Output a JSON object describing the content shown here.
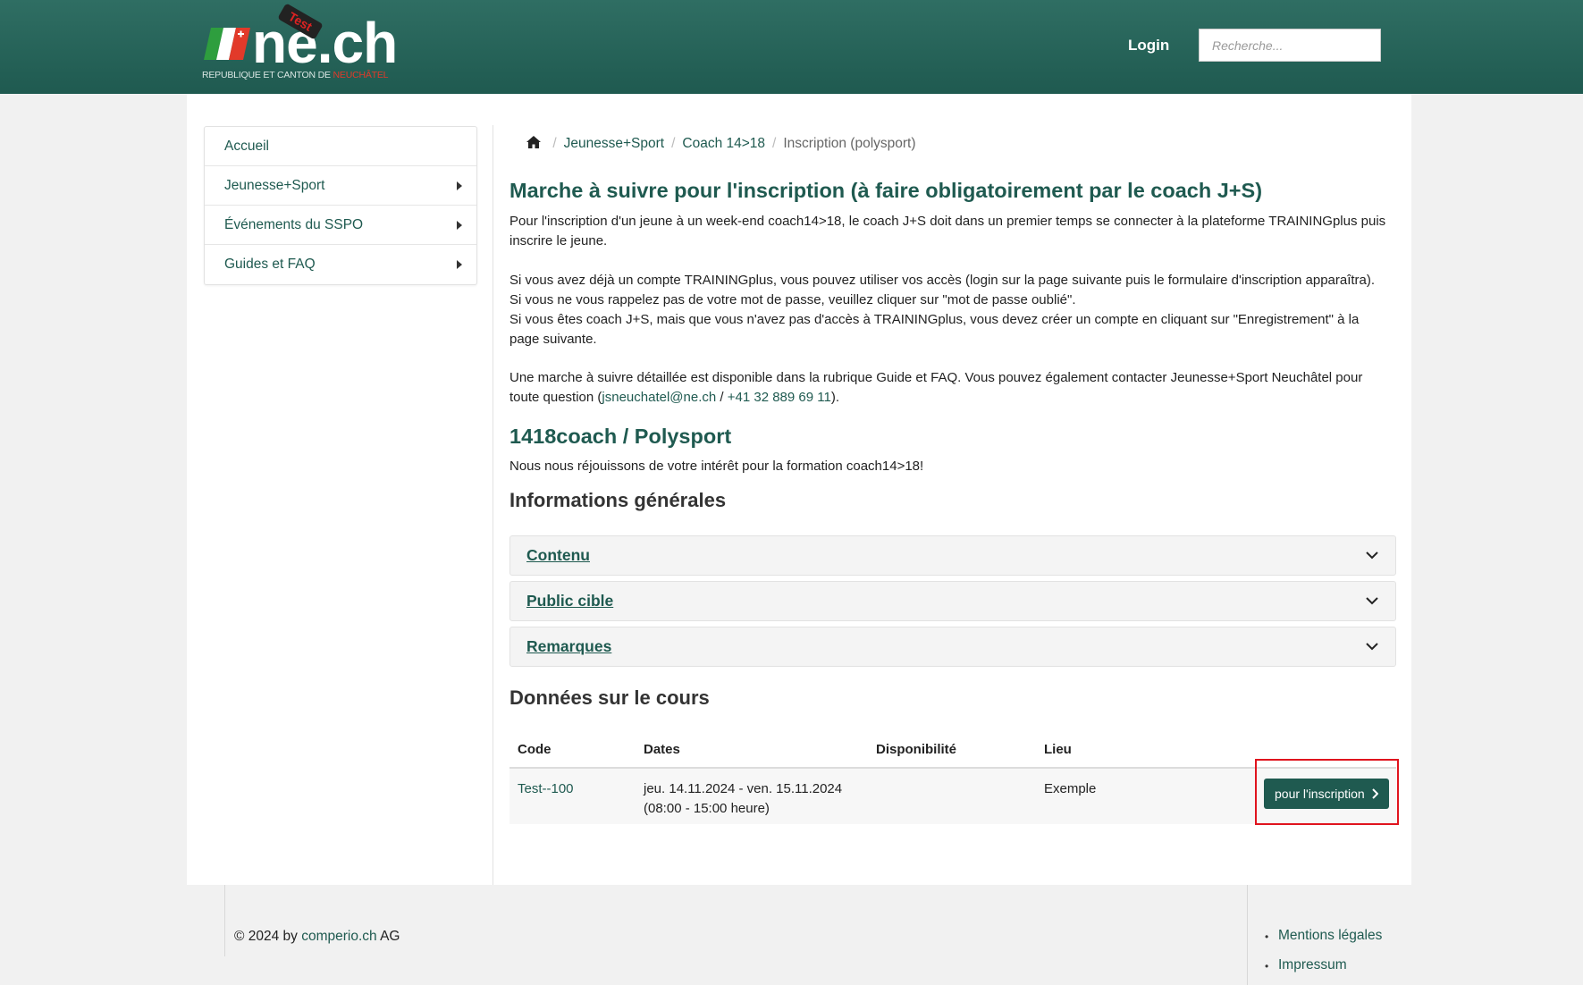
{
  "header": {
    "logo_text": "ne.ch",
    "logo_badge": "Test",
    "logo_subtitle_prefix": "REPUBLIQUE ET CANTON DE ",
    "logo_subtitle_highlight": "NEUCHÂTEL",
    "login_label": "Login",
    "search_placeholder": "Recherche..."
  },
  "sidebar": {
    "items": [
      {
        "label": "Accueil",
        "has_submenu": false
      },
      {
        "label": "Jeunesse+Sport",
        "has_submenu": true
      },
      {
        "label": "Événements du SSPO",
        "has_submenu": true
      },
      {
        "label": "Guides et FAQ",
        "has_submenu": true
      }
    ]
  },
  "breadcrumb": {
    "items": [
      "Jeunesse+Sport",
      "Coach 14>18"
    ],
    "current": "Inscription (polysport)"
  },
  "main": {
    "title": "Marche à suivre pour l'inscription (à faire obligatoirement par le coach J+S)",
    "p1": "Pour l'inscription d'un jeune à un week-end coach14>18, le coach J+S doit dans un premier temps se connecter à la plateforme TRAININGplus puis inscrire le jeune.",
    "p2_line1": "Si vous avez déjà un compte TRAININGplus, vous pouvez utiliser vos accès (login sur la page suivante puis le formulaire d'inscription apparaîtra).",
    "p2_line2": "Si vous ne vous rappelez pas de votre mot de passe, veuillez cliquer sur \"mot de passe oublié\".",
    "p2_line3": "Si vous êtes coach J+S, mais que vous n'avez pas d'accès à TRAININGplus, vous devez créer un compte en cliquant sur \"Enregistrement\" à la page suivante.",
    "p3_prefix": "Une marche à suivre détaillée est disponible dans la rubrique Guide et FAQ. Vous pouvez également contacter Jeunesse+Sport Neuchâtel pour toute question (",
    "p3_email": "jsneuchatel@ne.ch",
    "p3_sep": " / ",
    "p3_phone": "+41 32 889 69 11",
    "p3_suffix": ").",
    "course_title": "1418coach / Polysport",
    "course_intro": "Nous nous réjouissons de votre intérêt pour la formation coach14>18!",
    "general_info_title": "Informations générales",
    "accordions": [
      "Contenu",
      "Public cible",
      "Remarques"
    ],
    "course_data_title": "Données sur le cours"
  },
  "table": {
    "headers": [
      "Code",
      "Dates",
      "Disponibilité",
      "Lieu"
    ],
    "rows": [
      {
        "code": "Test--100",
        "dates_line1": "jeu. 14.11.2024 - ven. 15.11.2024",
        "dates_line2": "(08:00 - 15:00 heure)",
        "dispo": "",
        "lieu": "Exemple",
        "button_label": "pour l'inscription"
      }
    ]
  },
  "footer": {
    "copyright_prefix": "© 2024 by ",
    "copyright_link": "comperio.ch",
    "copyright_suffix": " AG",
    "links": [
      "Mentions légales",
      "Impressum"
    ]
  },
  "colors": {
    "brand_green": "#1f5a50",
    "header_gradient_top": "#2f6e63",
    "highlight_red": "#e0141e"
  },
  "icons": {
    "home": "home-icon",
    "submenu": "caret-right-icon",
    "accordion": "chevron-down-icon",
    "button": "chevron-right-icon"
  }
}
